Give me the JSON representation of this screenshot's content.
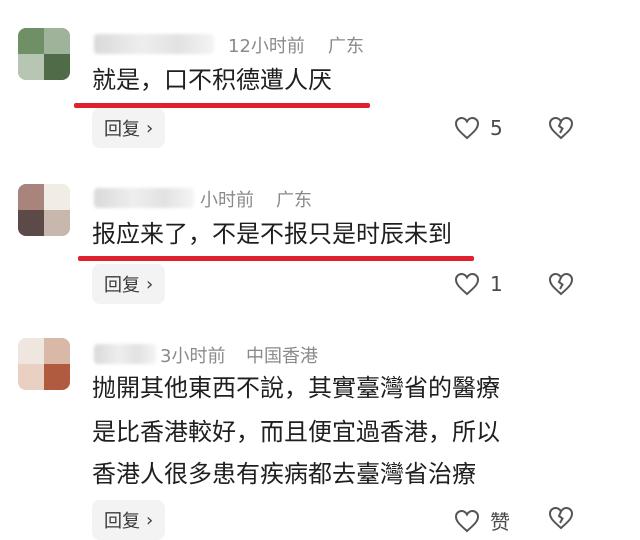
{
  "comments": [
    {
      "time": "12小时前",
      "location": "广东",
      "text": "就是，口不积德遭人厌",
      "reply_label": "回复",
      "likes": "5"
    },
    {
      "time": "小时前",
      "location": "广东",
      "text": "报应来了，不是不报只是时辰未到",
      "reply_label": "回复",
      "likes": "1"
    },
    {
      "time": "3小时前",
      "location": "中国香港",
      "lines": [
        "抛開其他東西不說，其實臺灣省的醫療",
        "是比香港較好，而且便宜過香港，所以",
        "香港人很多患有疾病都去臺灣省治療"
      ],
      "reply_label": "回复",
      "likes": "赞"
    }
  ],
  "icons": {
    "like": "heart-outline-icon",
    "dislike": "broken-heart-icon",
    "reply_chevron": "chevron-right-icon"
  },
  "colors": {
    "underline": "#e0202d",
    "meta_text": "#8a8a8a",
    "reply_bg": "#f3f3f3"
  }
}
